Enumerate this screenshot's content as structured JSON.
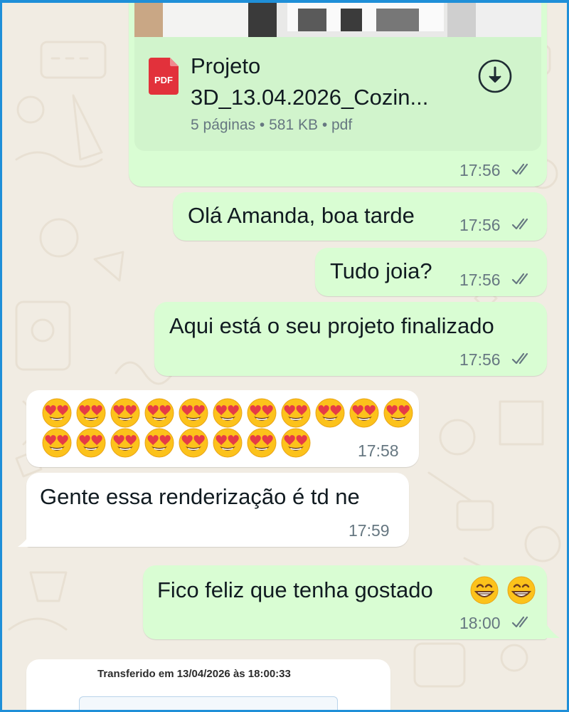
{
  "document_message": {
    "file_name_line1": "Projeto",
    "file_name_line2": "3D_13.04.2026_Cozin...",
    "file_badge": "PDF",
    "meta": "5 páginas • 581 KB • pdf",
    "time": "17:56",
    "download_icon": "download-icon"
  },
  "messages": [
    {
      "text": "Olá Amanda, boa tarde",
      "time": "17:56",
      "direction": "outgoing",
      "status": "read"
    },
    {
      "text": "Tudo joia?",
      "time": "17:56",
      "direction": "outgoing",
      "status": "read"
    },
    {
      "text": "Aqui está o seu projeto finalizado",
      "time": "17:56",
      "direction": "outgoing",
      "status": "read"
    },
    {
      "emoji": "heart-eyes-emoji",
      "emoji_count": 19,
      "time": "17:58",
      "direction": "incoming"
    },
    {
      "text": "Gente essa renderização é td ne",
      "time": "17:59",
      "direction": "incoming"
    },
    {
      "text": "Fico feliz que tenha gostado",
      "trailing_emoji": "grinning-emoji",
      "trailing_emoji_count": 2,
      "time": "18:00",
      "direction": "outgoing",
      "status": "read"
    }
  ],
  "transfer_preview": {
    "text": "Transferido em 13/04/2026 às 18:00:33"
  },
  "colors": {
    "outgoing_bubble": "#d9fdd3",
    "incoming_bubble": "#ffffff",
    "wallpaper": "#f1ece3",
    "frame": "#1f8fd8",
    "pdf_red": "#e2313b",
    "timestamp": "#667781"
  }
}
